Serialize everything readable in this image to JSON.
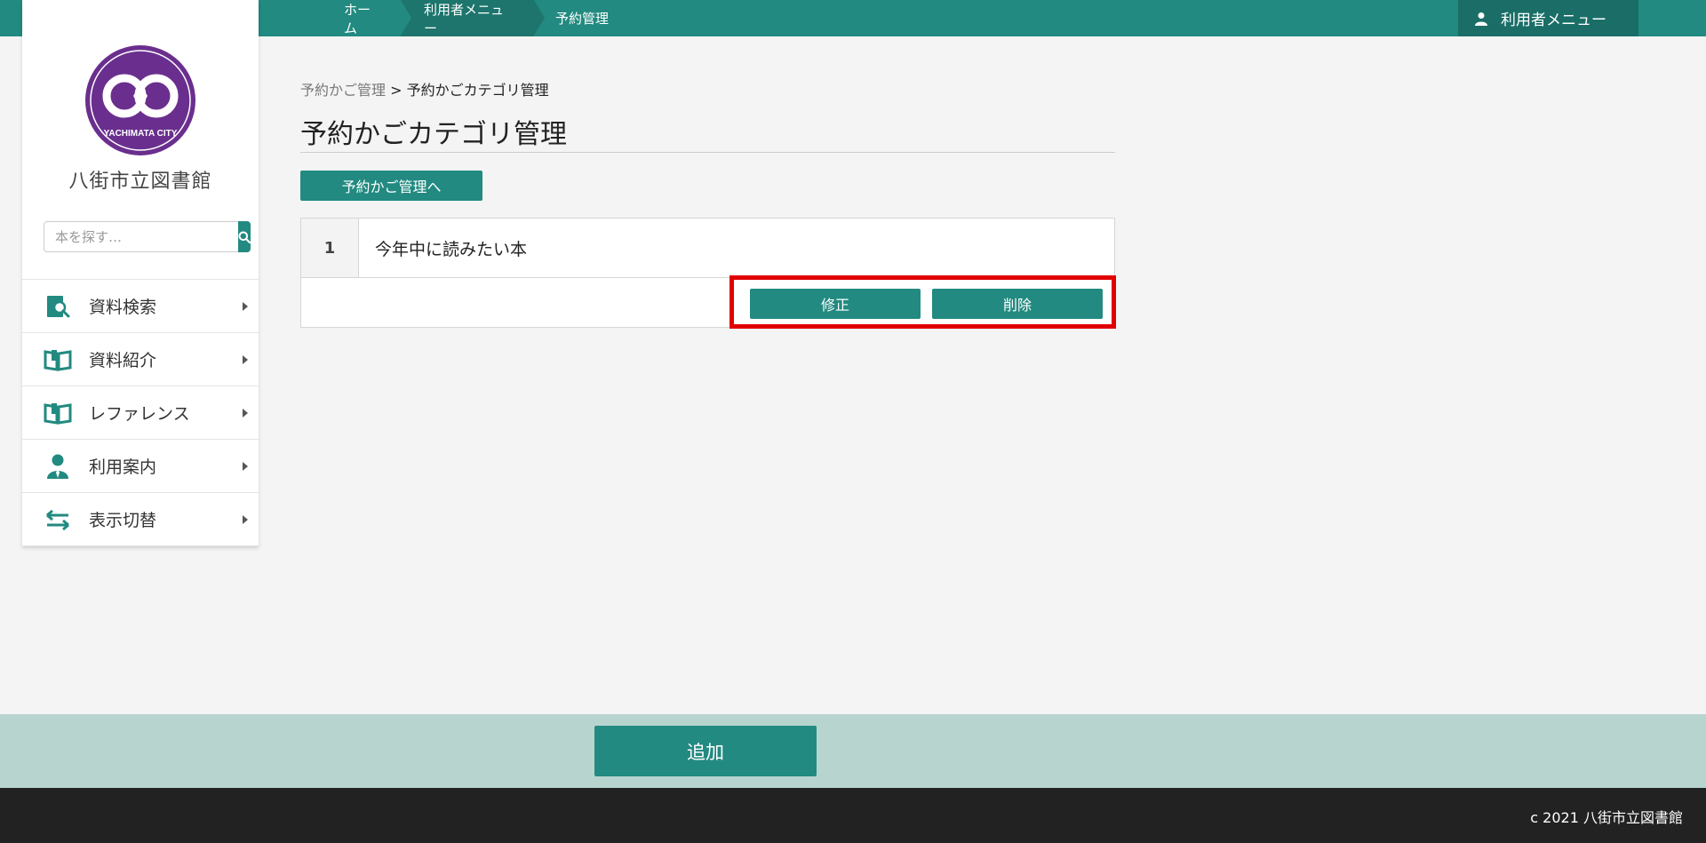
{
  "topbar": {
    "breadcrumbs": [
      "ホーム",
      "利用者メニュー",
      "予約管理"
    ],
    "user_menu_label": "利用者メニュー"
  },
  "sidebar": {
    "logo_text": "YACHIMATA CITY",
    "site_title": "八街市立図書館",
    "search_placeholder": "本を探す…",
    "nav_items": [
      {
        "label": "資料検索",
        "icon": "search-book-icon"
      },
      {
        "label": "資料紹介",
        "icon": "open-book-icon"
      },
      {
        "label": "レファレンス",
        "icon": "open-book-icon"
      },
      {
        "label": "利用案内",
        "icon": "person-icon"
      },
      {
        "label": "表示切替",
        "icon": "switch-arrows-icon"
      }
    ]
  },
  "main": {
    "path_parent": "予約かご管理",
    "path_separator": ">",
    "path_current": "予約かごカテゴリ管理",
    "page_title": "予約かごカテゴリ管理",
    "back_button": "予約かご管理へ",
    "categories": [
      {
        "number": "1",
        "name": "今年中に読みたい本"
      }
    ],
    "edit_button": "修正",
    "delete_button": "削除",
    "add_button": "追加"
  },
  "footer": {
    "copyright": "c 2021 八街市立図書館"
  },
  "colors": {
    "accent": "#228a80",
    "highlight": "#e10000",
    "addbar": "#b8d4cf",
    "footer": "#222222"
  }
}
